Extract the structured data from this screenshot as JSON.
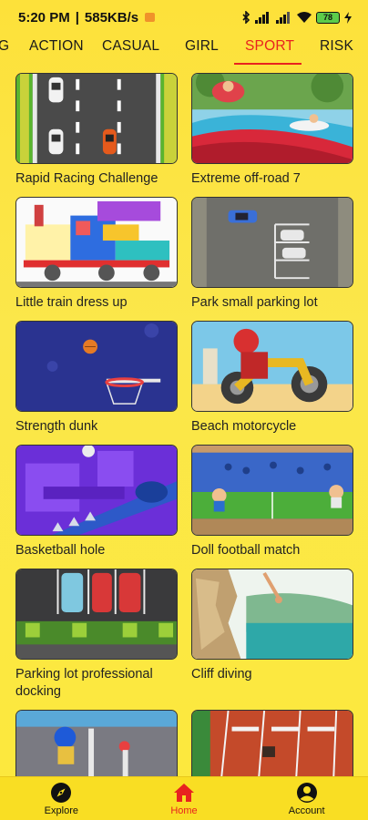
{
  "status": {
    "time": "5:20 PM",
    "speed": "585KB/s",
    "battery": "78"
  },
  "tabs": [
    {
      "label": "G",
      "active": false
    },
    {
      "label": "ACTION",
      "active": false
    },
    {
      "label": "CASUAL",
      "active": false
    },
    {
      "label": "GIRL",
      "active": false
    },
    {
      "label": "SPORT",
      "active": true
    },
    {
      "label": "RISK",
      "active": false
    }
  ],
  "games": [
    {
      "title": "Rapid Racing Challenge",
      "icon": "racing-thumbnail"
    },
    {
      "title": "Extreme off-road 7",
      "icon": "offroad-thumbnail"
    },
    {
      "title": "Little train dress up",
      "icon": "train-thumbnail"
    },
    {
      "title": "Park small parking lot",
      "icon": "parking-thumbnail"
    },
    {
      "title": "Strength dunk",
      "icon": "dunk-thumbnail"
    },
    {
      "title": "Beach motorcycle",
      "icon": "motorcycle-thumbnail"
    },
    {
      "title": "Basketball hole",
      "icon": "basketball-hole-thumbnail"
    },
    {
      "title": "Doll football match",
      "icon": "football-thumbnail"
    },
    {
      "title": "Parking lot professional docking",
      "icon": "docking-thumbnail"
    },
    {
      "title": "Cliff diving",
      "icon": "cliff-diving-thumbnail"
    },
    {
      "title": "",
      "icon": "moto-boy-thumbnail"
    },
    {
      "title": "",
      "icon": "hurdles-thumbnail"
    }
  ],
  "nav": [
    {
      "label": "Explore",
      "icon": "compass-icon",
      "active": false
    },
    {
      "label": "Home",
      "icon": "home-icon",
      "active": true
    },
    {
      "label": "Account",
      "icon": "account-icon",
      "active": false
    }
  ],
  "colors": {
    "background": "#fde13a",
    "accent": "#e8221f",
    "nav_bg": "#f9de23"
  }
}
